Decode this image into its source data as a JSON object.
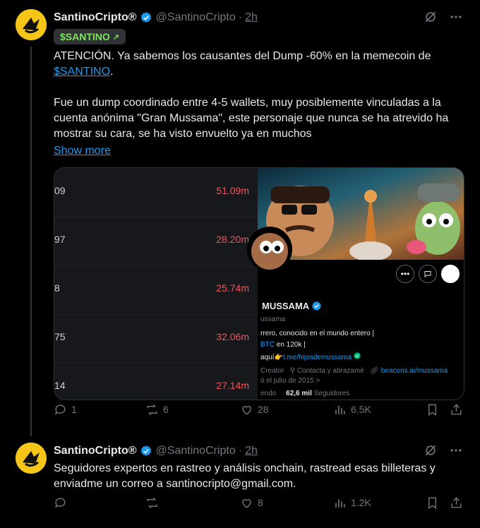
{
  "tweet1": {
    "name": "SantinoCripto®",
    "handle": "@SantinoCripto",
    "separator": "·",
    "time": "2h",
    "tag": "$SANTINO",
    "tag_arrow": "↗",
    "para1_a": "ATENCIÓN. Ya sabemos los causantes del Dump -60% en la memecoin de ",
    "para1_link": "$SANTINO",
    "para1_b": ".",
    "para2": "Fue un dump coordinado entre 4-5 wallets, muy posiblemente vinculadas a la cuenta anónima \"Gran Mussama\", este personaje que nunca se ha atrevido ha mostrar su cara, se ha visto envuelto ya en muchos",
    "show_more": "Show more",
    "media": {
      "rows": [
        {
          "left": "09",
          "right": "51.09m"
        },
        {
          "left": "97",
          "right": "28.20m"
        },
        {
          "left": "8",
          "right": "25.74m"
        },
        {
          "left": "75",
          "right": "32.06m"
        },
        {
          "left": "14",
          "right": "27.14m"
        }
      ],
      "profile": {
        "name": "MUSSAMA",
        "handle": "ussama",
        "bio1": "rrero, conocido en el mundo entero |",
        "bio2_link": "BTC",
        "bio2": " en 120k  |",
        "bio3_a": "aquí👉",
        "bio3_link": "t.me/hijosdemussama",
        "meta_a": "Creator",
        "meta_b": "Contacta y abrazamé",
        "meta_link": "beacons.ai/mussama",
        "joined": "ó el julio de 2015 >",
        "following": "endo",
        "followers_count": "62,6 mil",
        "followers_label": "Seguidores"
      }
    },
    "actions": {
      "replies": "1",
      "reposts": "6",
      "likes": "28",
      "views": "6.5K"
    }
  },
  "tweet2": {
    "name": "SantinoCripto®",
    "handle": "@SantinoCripto",
    "separator": "·",
    "time": "2h",
    "text": "Seguidores expertos en rastreo y análisis onchain, rastread esas billeteras y enviadme un correo a santinocripto@gmail.com.",
    "actions": {
      "replies": "",
      "reposts": "",
      "likes": "8",
      "views": "1.2K"
    }
  },
  "colors": {
    "accent": "#1d9bf0",
    "tag_green": "#7ce35b",
    "negative": "#f0555d",
    "muted": "#71767b",
    "avatar_bg": "#f5c518"
  }
}
